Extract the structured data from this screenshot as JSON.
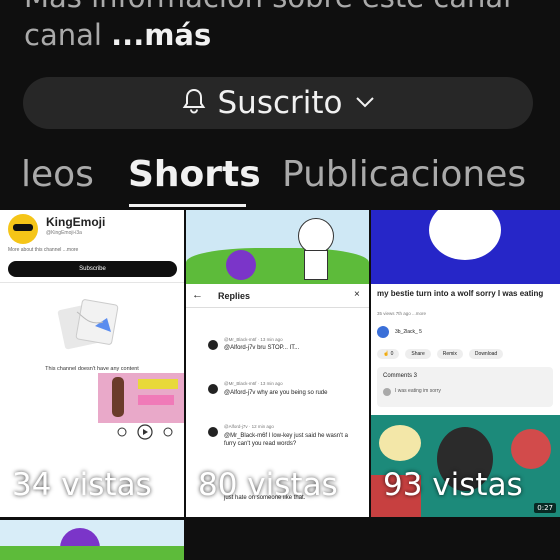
{
  "channel": {
    "description": "Más información sobre este canal",
    "description_line2": "canal",
    "more_label": "...más"
  },
  "subscribe": {
    "label": "Suscrito",
    "bell_icon": "bell-icon",
    "chevron_icon": "chevron-down-icon"
  },
  "tabs": [
    {
      "label": "Videos",
      "visible_label": "leos"
    },
    {
      "label": "Shorts"
    },
    {
      "label": "Publicaciones"
    }
  ],
  "shorts": [
    {
      "views": "34 vistas",
      "thumb": {
        "channel_name": "KingEmoji",
        "handle": "@KingEmoji-i3a",
        "about": "More about this channel ...more",
        "subscribe": "Subscribe",
        "empty": "This channel doesn't have any content"
      }
    },
    {
      "views": "80 vistas",
      "thumb": {
        "title": "Replies",
        "comments": [
          {
            "user": "@Mr_Black-m6f · 13 min ago",
            "text": "@Alford-j7v  bru STOP... IT..."
          },
          {
            "user": "@Mr_Black-m6f · 13 min ago",
            "text": "@Alford-j7v  why are you being so rude"
          },
          {
            "user": "@Alford-j7v · 12 min ago",
            "text": "@Mr_Black-m6f  I low-key just said he wasn't a furry can't you read words?"
          }
        ],
        "footer": "just hate on someone like that."
      }
    },
    {
      "views": "93 vistas",
      "thumb": {
        "caption": "my bestie turn into a wolf sorry I was eating",
        "meta": "35 views 7th ago ...more",
        "author": "3b_2lack_ 5",
        "share": "Share",
        "remix": "Remix",
        "download": "Download",
        "comments_label": "Comments 3",
        "comment": "I was eating im sorry",
        "duration": "0:27"
      }
    }
  ]
}
